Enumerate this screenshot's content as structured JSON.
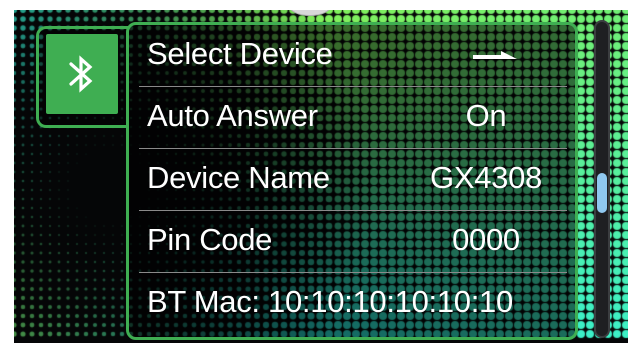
{
  "settings": {
    "category_icon": "bluetooth-icon",
    "accent_color": "#3fae52",
    "rows": [
      {
        "label": "Select Device",
        "value": "",
        "value_icon": "arrow-right-icon"
      },
      {
        "label": "Auto Answer",
        "value": "On"
      },
      {
        "label": "Device Name",
        "value": "GX4308"
      },
      {
        "label": "Pin Code",
        "value": "0000"
      },
      {
        "label": "BT Mac: 10:10:10:10:10:10"
      }
    ]
  },
  "scroll": {
    "position": 0.55
  }
}
